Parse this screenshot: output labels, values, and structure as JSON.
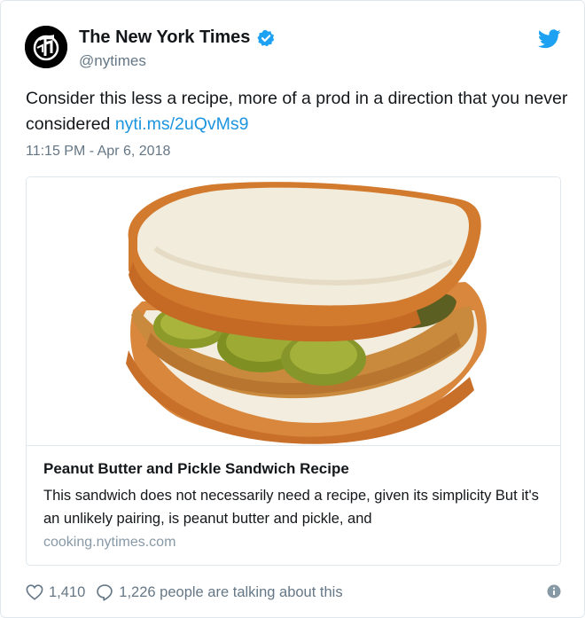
{
  "account": {
    "name": "The New York Times",
    "handle": "@nytimes",
    "verified_color": "#1da1f2"
  },
  "tweet": {
    "text": "Consider this less a recipe, more of a prod in a direction that you never considered ",
    "link": "nyti.ms/2uQvMs9",
    "timestamp": "11:15 PM - Apr 6, 2018"
  },
  "card": {
    "title": "Peanut Butter and Pickle Sandwich Recipe",
    "description": "This sandwich does not necessarily need a recipe, given its simplicity But it's an unlikely pairing, is peanut butter and pickle, and",
    "domain": "cooking.nytimes.com",
    "image_icon": "sandwich-image"
  },
  "footer": {
    "likes": "1,410",
    "talking": "1,226 people are talking about this"
  },
  "colors": {
    "link": "#1b95e0",
    "twitter_brand": "#1da1f2",
    "muted": "#657786"
  }
}
